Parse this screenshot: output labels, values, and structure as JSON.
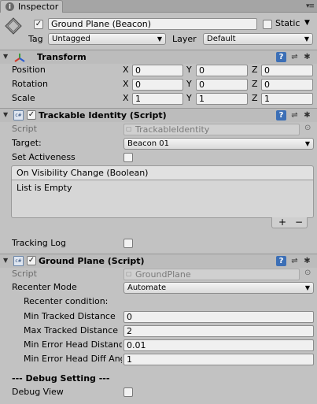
{
  "window": {
    "tab_label": "Inspector"
  },
  "object": {
    "name": "Ground Plane (Beacon)",
    "static_label": "Static",
    "tag_label": "Tag",
    "tag_value": "Untagged",
    "layer_label": "Layer",
    "layer_value": "Default"
  },
  "transform": {
    "title": "Transform",
    "rows": [
      {
        "label": "Position",
        "x": "0",
        "y": "0",
        "z": "0"
      },
      {
        "label": "Rotation",
        "x": "0",
        "y": "0",
        "z": "0"
      },
      {
        "label": "Scale",
        "x": "1",
        "y": "1",
        "z": "1"
      }
    ],
    "axis_x": "X",
    "axis_y": "Y",
    "axis_z": "Z"
  },
  "trackable": {
    "title": "Trackable Identity (Script)",
    "script_label": "Script",
    "script_value": "TrackableIdentity",
    "target_label": "Target:",
    "target_value": "Beacon 01",
    "set_activeness_label": "Set Activeness",
    "event_title": "On Visibility Change (Boolean)",
    "event_empty": "List is Empty",
    "add": "+",
    "remove": "−",
    "tracking_log_label": "Tracking Log"
  },
  "ground": {
    "title": "Ground Plane (Script)",
    "script_label": "Script",
    "script_value": "GroundPlane",
    "recenter_mode_label": "Recenter Mode",
    "recenter_mode_value": "Automate",
    "recenter_condition_label": "Recenter condition:",
    "fields": [
      {
        "label": "Min Tracked Distance",
        "value": "0"
      },
      {
        "label": "Max Tracked Distance",
        "value": "2"
      },
      {
        "label": "Min Error Head Distance",
        "value": "0.01"
      },
      {
        "label": "Min Error Head Diff Angle",
        "value": "1"
      }
    ],
    "debug_header": "--- Debug Setting ---",
    "debug_view_label": "Debug View"
  },
  "icons": {
    "help": "?",
    "preset": "⇌",
    "gear": "✱",
    "cs": "c#",
    "triangle": "▼",
    "dropdown": "▼",
    "tab_icon": "i",
    "menu": "▾≡"
  }
}
